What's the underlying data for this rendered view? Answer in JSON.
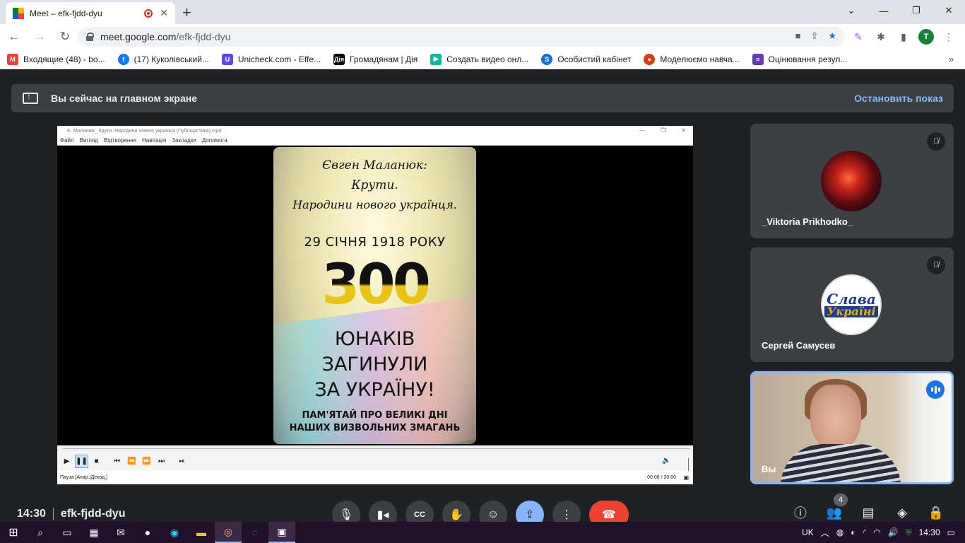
{
  "browser": {
    "tab_title": "Meet – efk-fjdd-dyu",
    "url_domain": "meet.google.com",
    "url_path": "/efk-fjdd-dyu",
    "profile_initial": "T"
  },
  "bookmarks": [
    {
      "label": "Входящие (48) - bo...",
      "icon": "gmail-icon",
      "color": "#ea4335"
    },
    {
      "label": "(17) Куколівський...",
      "icon": "facebook-icon",
      "color": "#1877f2"
    },
    {
      "label": "Unicheck.com - Effe...",
      "icon": "unicheck-icon",
      "color": "#5b4bdb"
    },
    {
      "label": "Громадянам | Дія",
      "icon": "diia-icon",
      "color": "#000000"
    },
    {
      "label": "Создать видео онл...",
      "icon": "video-maker-icon",
      "color": "#16b59e"
    },
    {
      "label": "Особистий кабінет",
      "icon": "cabinet-icon",
      "color": "#1f6fd1"
    },
    {
      "label": "Моделюємо навча...",
      "icon": "model-icon",
      "color": "#d93a1a"
    },
    {
      "label": "Оцінювання резул...",
      "icon": "forms-icon",
      "color": "#673ab7"
    }
  ],
  "meet": {
    "banner_text": "Вы сейчас на главном экране",
    "stop_label": "Остановить показ",
    "time": "14:30",
    "meeting_code": "efk-fjdd-dyu",
    "participants_count": "4",
    "participants": [
      {
        "name": "_Viktoria Prikhodko_"
      },
      {
        "name": "Сергей Самусев"
      },
      {
        "name": "Вы"
      }
    ]
  },
  "player": {
    "window_title": "Є. Маланюк_ Крути. Народини нового українця (Публіцистика).mp4",
    "menu": [
      "Файл",
      "Вигляд",
      "Відтворення",
      "Навігація",
      "Закладки",
      "Допомога"
    ],
    "status": "Пауза [Апар./Декод.]",
    "time": "00:08 / 30:00"
  },
  "poster": {
    "line1": "Євген Маланюк:",
    "line2": "Крути.",
    "line3": "Народини нового українця.",
    "date": "29 СІЧНЯ 1918 РОКУ",
    "number": "300",
    "y1": "ЮНАКІВ",
    "y2": "ЗАГИНУЛИ",
    "y3": "ЗА УКРАЇНУ!",
    "m1": "ПАМ'ЯТАЙ ПРО ВЕЛИКІ ДНІ",
    "m2": "НАШИХ ВИЗВОЛЬНИХ ЗМАГАНЬ"
  },
  "avatar2_text": {
    "a": "Слава",
    "b": "Україні"
  },
  "taskbar": {
    "lang": "UK",
    "time": "14:30"
  }
}
